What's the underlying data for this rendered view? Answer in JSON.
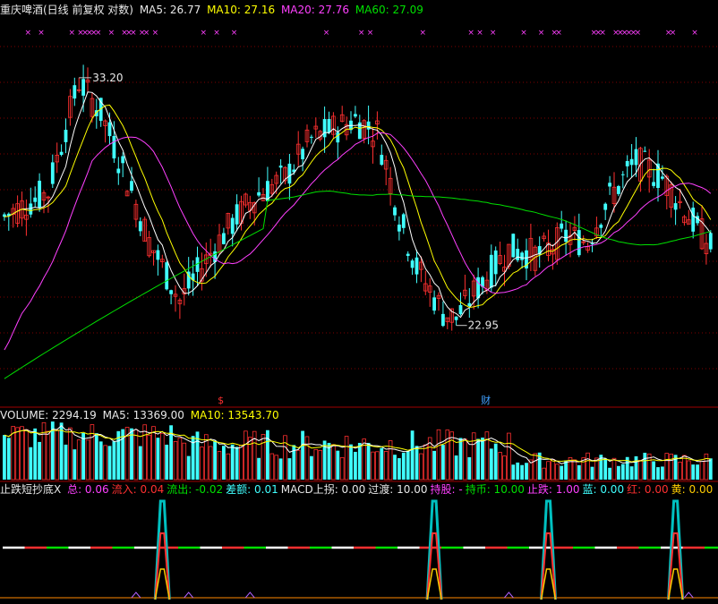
{
  "header": {
    "title": "重庆啤酒(日线 前复权 对数)",
    "ma": [
      {
        "label": "MA5: 26.77",
        "color": "#ffffff"
      },
      {
        "label": "MA10: 27.16",
        "color": "#ffff00"
      },
      {
        "label": "MA20: 27.76",
        "color": "#ff40ff"
      },
      {
        "label": "MA60: 27.09",
        "color": "#00e000"
      }
    ]
  },
  "volume_header": {
    "label": "VOLUME: 2294.19",
    "ma5": "MA5: 13369.00",
    "ma10": "MA10: 13543.70"
  },
  "indicator_header": {
    "name": "止跌短抄底X",
    "items": [
      {
        "label": "总:",
        "value": "0.06",
        "color": "#ff40ff"
      },
      {
        "label": "流入:",
        "value": "0.04",
        "color": "#ff3030"
      },
      {
        "label": "流出:",
        "value": "-0.02",
        "color": "#00e000"
      },
      {
        "label": "差额:",
        "value": "0.01",
        "color": "#40ffff"
      },
      {
        "label": "MACD上拐:",
        "value": "0.00",
        "color": "#e8e8e8"
      },
      {
        "label": "过渡:",
        "value": "10.00",
        "color": "#e8e8e8"
      },
      {
        "label": "持股:",
        "value": "-",
        "color": "#ff40ff"
      },
      {
        "label": "持币:",
        "value": "10.00",
        "color": "#00e000"
      },
      {
        "label": "止跌:",
        "value": "1.00",
        "color": "#ff40ff"
      },
      {
        "label": "蓝:",
        "value": "0.00",
        "color": "#40ffff"
      },
      {
        "label": "红:",
        "value": "0.00",
        "color": "#ff3030"
      },
      {
        "label": "黄:",
        "value": "0.00",
        "color": "#ffcc00"
      }
    ]
  },
  "chart_data": {
    "type": "candlestick",
    "price_range": [
      20.4,
      36.2
    ],
    "log_scale": true,
    "annotations": {
      "high": {
        "label": "33.20",
        "value": 33.2,
        "bar": 17
      },
      "low": {
        "label": "22.95",
        "value": 22.95,
        "bar": 103
      }
    },
    "event_markers": [
      {
        "label": "$",
        "bar": 49,
        "color": "#ff3030"
      },
      {
        "label": "财",
        "bar": 109,
        "color": "#40a0ff"
      }
    ],
    "colors": {
      "up": "#ff3030",
      "down": "#40ffff",
      "ma5": "#ffffff",
      "ma10": "#ffff00",
      "ma20": "#ff40ff",
      "ma60": "#00e000"
    },
    "indicator_spikes": [
      36,
      98,
      124,
      153
    ]
  }
}
